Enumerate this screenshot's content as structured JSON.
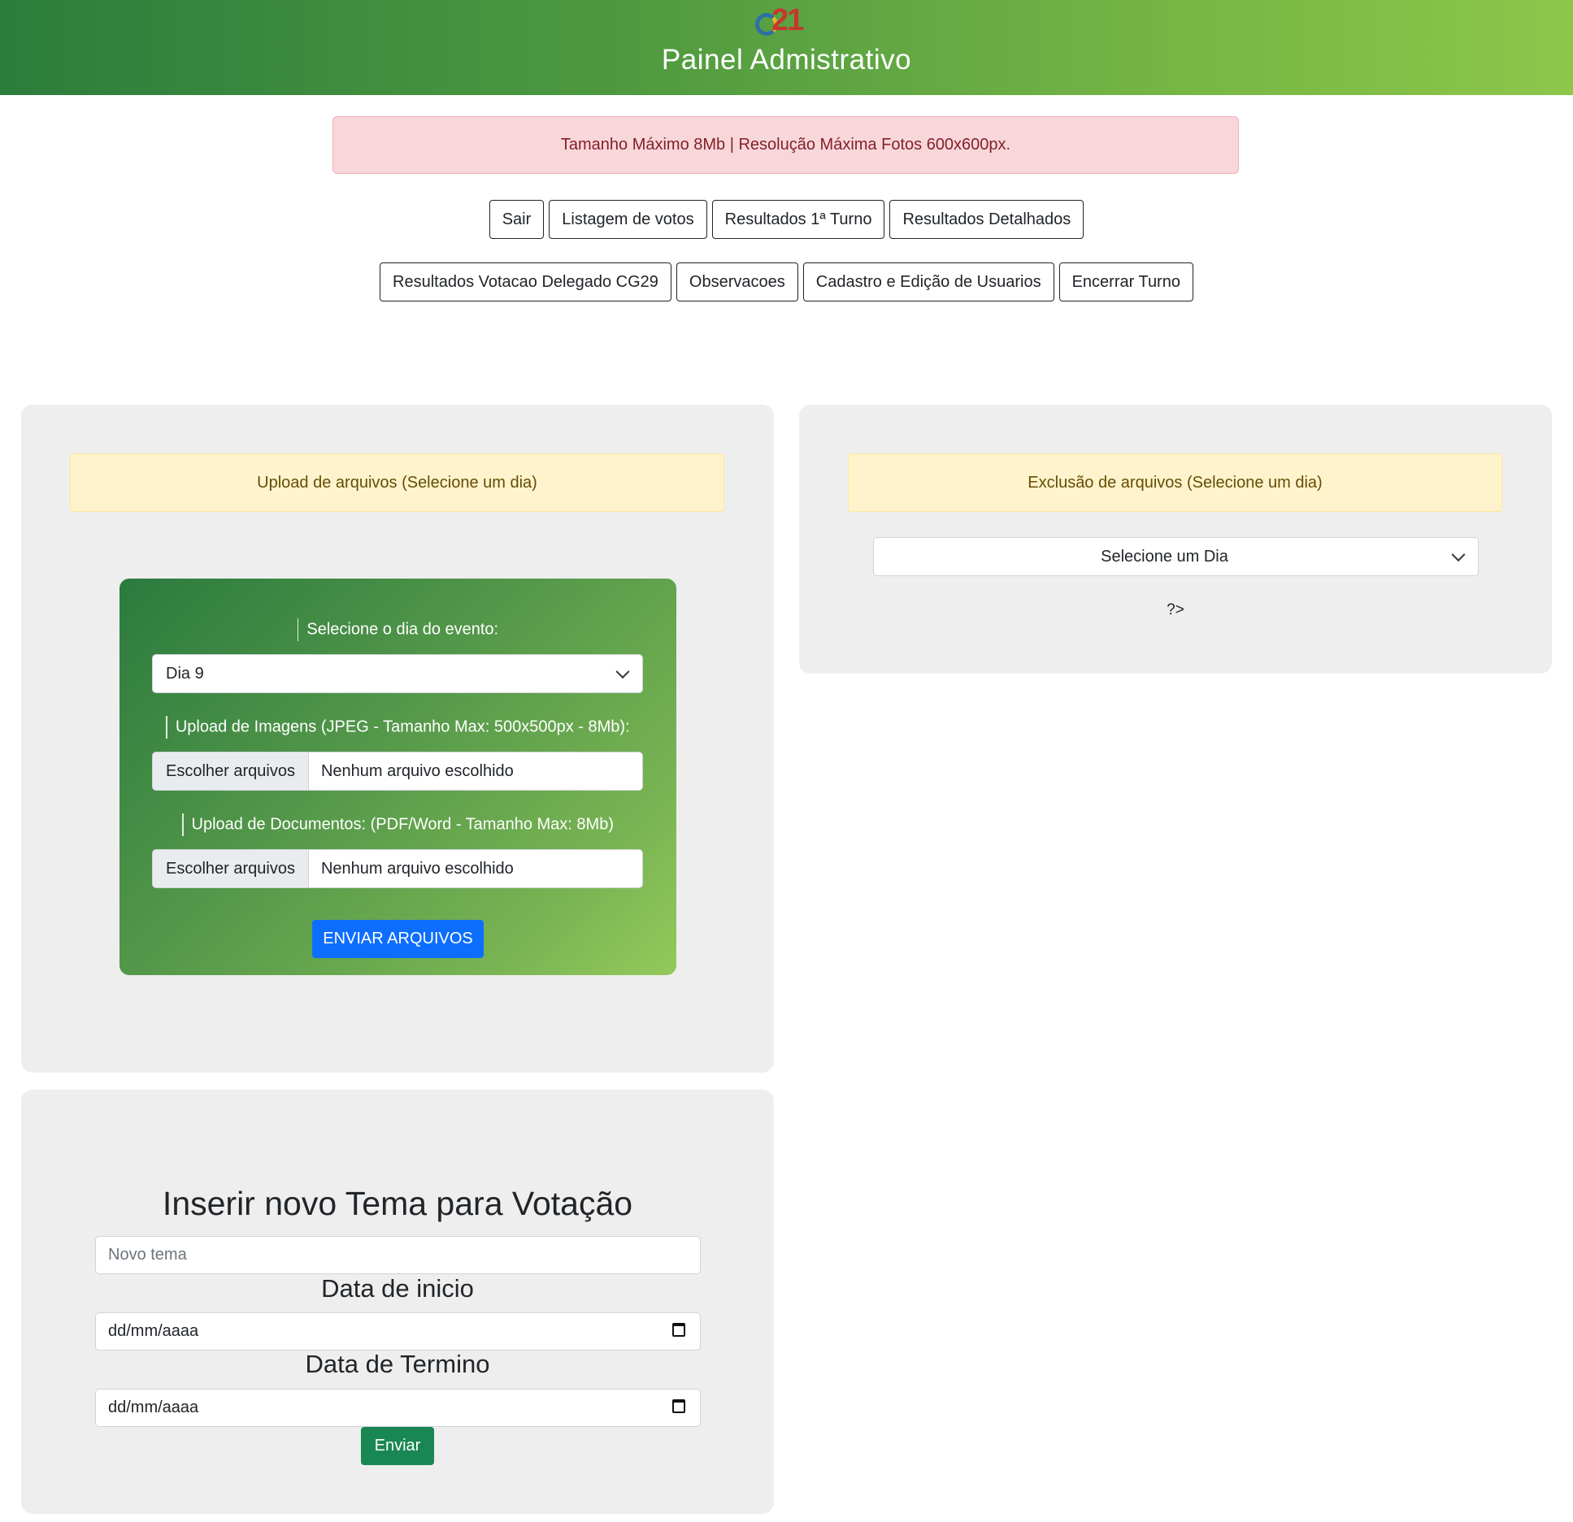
{
  "header": {
    "logo_text": "21",
    "title": "Painel Admistrativo"
  },
  "alert": {
    "text": "Tamanho Máximo 8Mb | Resolução Máxima Fotos 600x600px."
  },
  "nav": {
    "row1": [
      "Sair",
      "Listagem de votos",
      "Resultados 1ª Turno",
      "Resultados Detalhados"
    ],
    "row2": [
      "Resultados Votacao Delegado CG29",
      "Observacoes",
      "Cadastro e Edição de Usuarios",
      "Encerrar Turno"
    ]
  },
  "upload": {
    "heading": "Upload de arquivos (Selecione um dia)",
    "day_label": "Selecione o dia do evento:",
    "day_value": "Dia 9",
    "images_label": "Upload de Imagens (JPEG - Tamanho Max: 500x500px - 8Mb):",
    "docs_label": "Upload de Documentos: (PDF/Word - Tamanho Max: 8Mb)",
    "file_button": "Escolher arquivos",
    "file_status": "Nenhum arquivo escolhido",
    "submit": "ENVIAR ARQUIVOS"
  },
  "delete": {
    "heading": "Exclusão de arquivos (Selecione um dia)",
    "select_value": "Selecione um Dia",
    "stray_text": "?>"
  },
  "tema": {
    "title": "Inserir novo Tema para Votação",
    "input_placeholder": "Novo tema",
    "start_label": "Data de inicio",
    "end_label": "Data de Termino",
    "date_placeholder": "dd/mm/aaaa",
    "submit": "Enviar"
  },
  "colors": {
    "header_gradient_start": "#2c7c3c",
    "header_gradient_end": "#8dc64a",
    "primary_button": "#0d6efd",
    "success_button": "#198754"
  }
}
